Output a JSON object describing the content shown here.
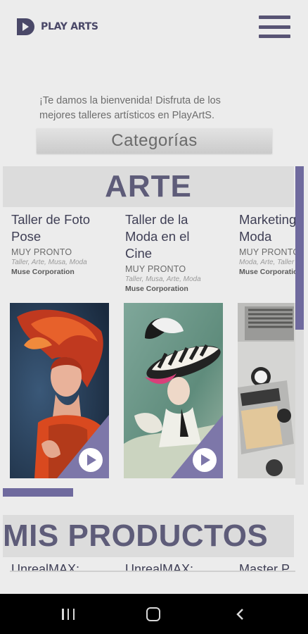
{
  "header": {
    "brand": "PLAY ARTS",
    "logo_icon": "play-arts-logo-icon",
    "menu_icon": "hamburger-menu-icon"
  },
  "welcome": {
    "line1": "¡Te damos la bienvenida! Disfruta de los",
    "line2": "mejores talleres artísticos en PlayArtS."
  },
  "categories_label": "Categorías",
  "section_arte": {
    "title": "ARTE",
    "cards": [
      {
        "title_line1": "Taller de Foto",
        "title_line2": "Pose",
        "title_line3": "",
        "status": "MUY PRONTO",
        "tags": "Taller, Arte, Musa, Moda",
        "org": "Muse Corporation",
        "image": "woman-flowing-red-hair-photo"
      },
      {
        "title_line1": "Taller de la",
        "title_line2": "Moda en el",
        "title_line3": "Cine",
        "status": "MUY PRONTO",
        "tags": "Taller, Musa, Arte, Moda",
        "org": "Muse Corporation",
        "image": "woman-striped-feather-hat-photo"
      },
      {
        "title_line1": "Marketing",
        "title_line2": "Moda",
        "title_line3": "",
        "status": "MUY PRONTO",
        "tags": "Moda, Arte, Taller",
        "org": "Muse Corporation",
        "image": "desk-laptop-magazine-photo"
      }
    ]
  },
  "section_productos": {
    "title": "MIS PRODUCTOS",
    "items": [
      "UnrealMAX:",
      "UnrealMAX:",
      "Master P"
    ]
  },
  "colors": {
    "accent": "#6f6a9e",
    "title_text": "#5e5c79",
    "band": "#dcdcdc",
    "background": "#ececec"
  },
  "navbar": {
    "recent_icon": "recent-apps-icon",
    "home_icon": "home-icon",
    "back_icon": "back-icon"
  }
}
